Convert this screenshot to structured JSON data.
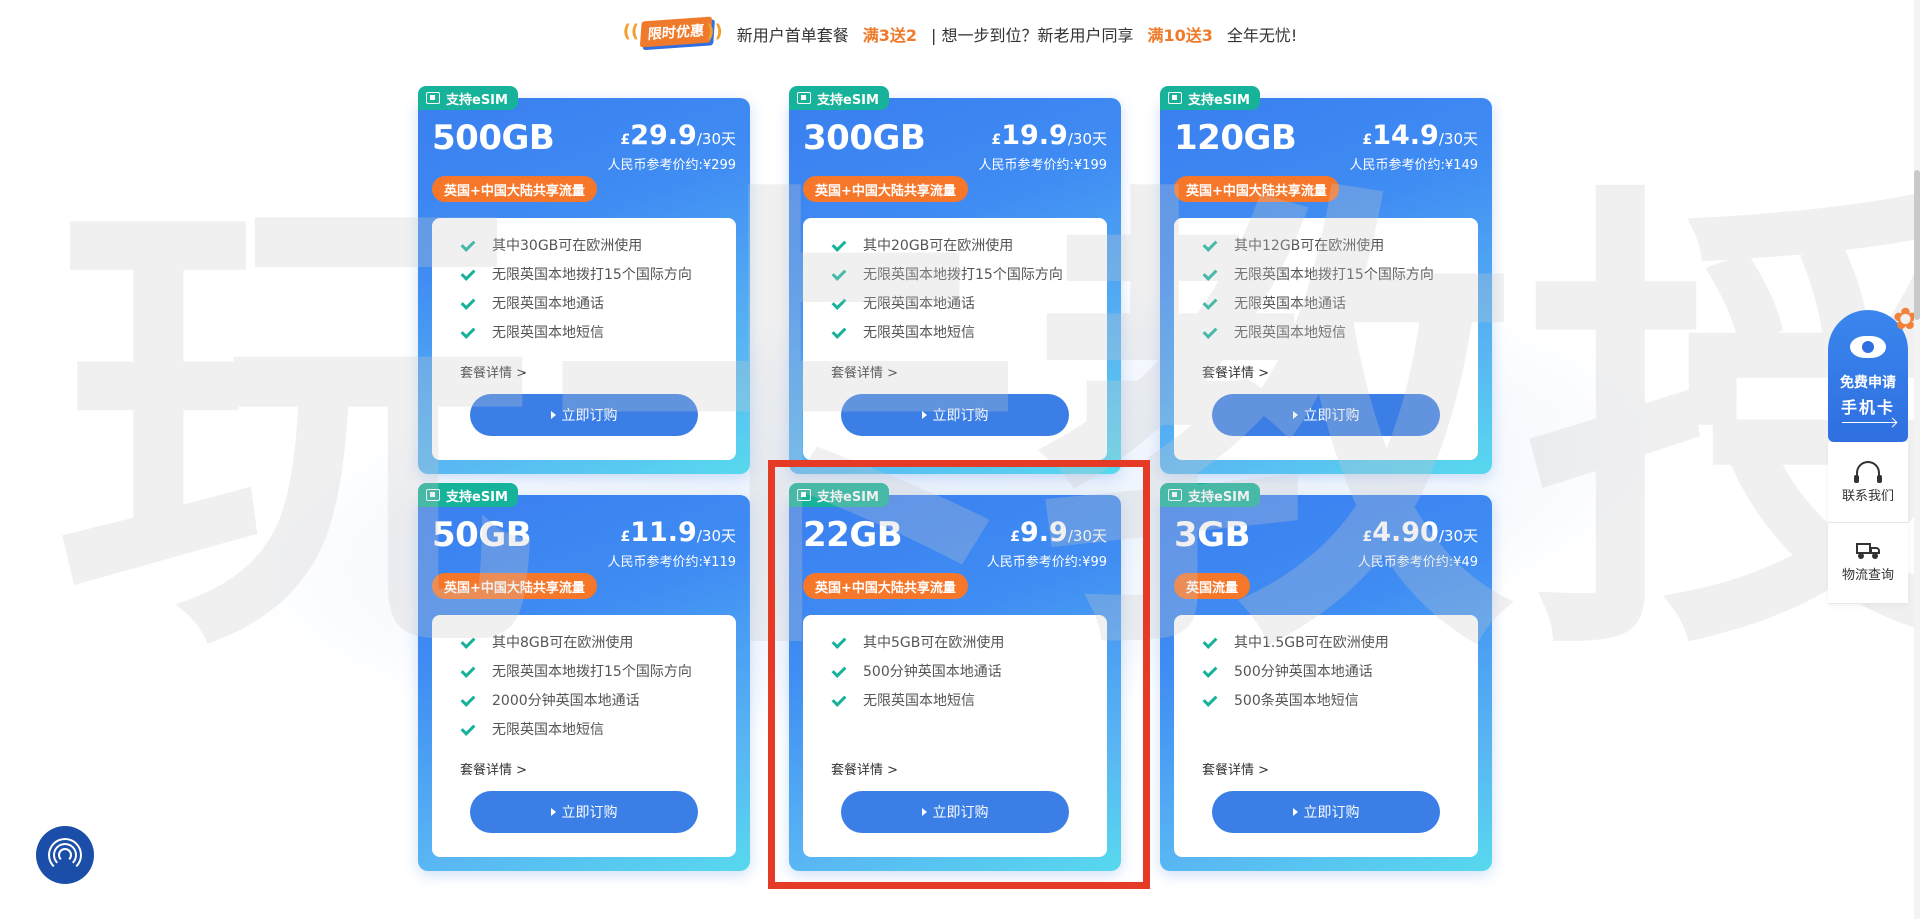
{
  "promo": {
    "badge": "限时优惠",
    "text_a": "新用户首单套餐",
    "hl_a": "满3送2",
    "text_b": "| 想一步到位？新老用户同享",
    "hl_b": "满10送3",
    "text_c": "全年无忧!"
  },
  "watermark": "玩卡教授",
  "plans": [
    {
      "tag": "支持eSIM",
      "data": "500GB",
      "currency": "£",
      "price": "29.9",
      "period": "/30天",
      "ref": "人民币参考价约:¥299",
      "coverage": "英国+中国大陆共享流量",
      "features": [
        "其中30GB可在欧洲使用",
        "无限英国本地拨打15个国际方向",
        "无限英国本地通话",
        "无限英国本地短信"
      ],
      "details": "套餐详情 >",
      "buy": "立即订购"
    },
    {
      "tag": "支持eSIM",
      "data": "300GB",
      "currency": "£",
      "price": "19.9",
      "period": "/30天",
      "ref": "人民币参考价约:¥199",
      "coverage": "英国+中国大陆共享流量",
      "features": [
        "其中20GB可在欧洲使用",
        "无限英国本地拨打15个国际方向",
        "无限英国本地通话",
        "无限英国本地短信"
      ],
      "details": "套餐详情 >",
      "buy": "立即订购"
    },
    {
      "tag": "支持eSIM",
      "data": "120GB",
      "currency": "£",
      "price": "14.9",
      "period": "/30天",
      "ref": "人民币参考价约:¥149",
      "coverage": "英国+中国大陆共享流量",
      "features": [
        "其中12GB可在欧洲使用",
        "无限英国本地拨打15个国际方向",
        "无限英国本地通话",
        "无限英国本地短信"
      ],
      "details": "套餐详情 >",
      "buy": "立即订购"
    },
    {
      "tag": "支持eSIM",
      "data": "50GB",
      "currency": "£",
      "price": "11.9",
      "period": "/30天",
      "ref": "人民币参考价约:¥119",
      "coverage": "英国+中国大陆共享流量",
      "features": [
        "其中8GB可在欧洲使用",
        "无限英国本地拨打15个国际方向",
        "2000分钟英国本地通话",
        "无限英国本地短信"
      ],
      "details": "套餐详情 >",
      "buy": "立即订购"
    },
    {
      "tag": "支持eSIM",
      "data": "22GB",
      "currency": "£",
      "price": "9.9",
      "period": "/30天",
      "ref": "人民币参考价约:¥99",
      "coverage": "英国+中国大陆共享流量",
      "features": [
        "其中5GB可在欧洲使用",
        "500分钟英国本地通话",
        "无限英国本地短信"
      ],
      "details": "套餐详情 >",
      "buy": "立即订购"
    },
    {
      "tag": "支持eSIM",
      "data": "3GB",
      "currency": "£",
      "price": "4.90",
      "period": "/30天",
      "ref": "人民币参考价约:¥49",
      "coverage": "英国流量",
      "features": [
        "其中1.5GB可在欧洲使用",
        "500分钟英国本地通话",
        "500条英国本地短信"
      ],
      "details": "套餐详情 >",
      "buy": "立即订购"
    }
  ],
  "side": {
    "apply_line1": "免费申请",
    "apply_line2": "手机卡",
    "contact": "联系我们",
    "logistics": "物流查询"
  },
  "icons": [
    "esim-chip-icon",
    "check-icon",
    "play-triangle-icon",
    "eye-icon",
    "bow-icon",
    "headset-icon",
    "truck-icon",
    "fingerprint-icon"
  ],
  "colors": {
    "accent": "#3b7fe6",
    "tag": "#17b29a",
    "coverage": "#f7772a",
    "highlight": "#e43a26",
    "promo": "#f07a2b"
  }
}
